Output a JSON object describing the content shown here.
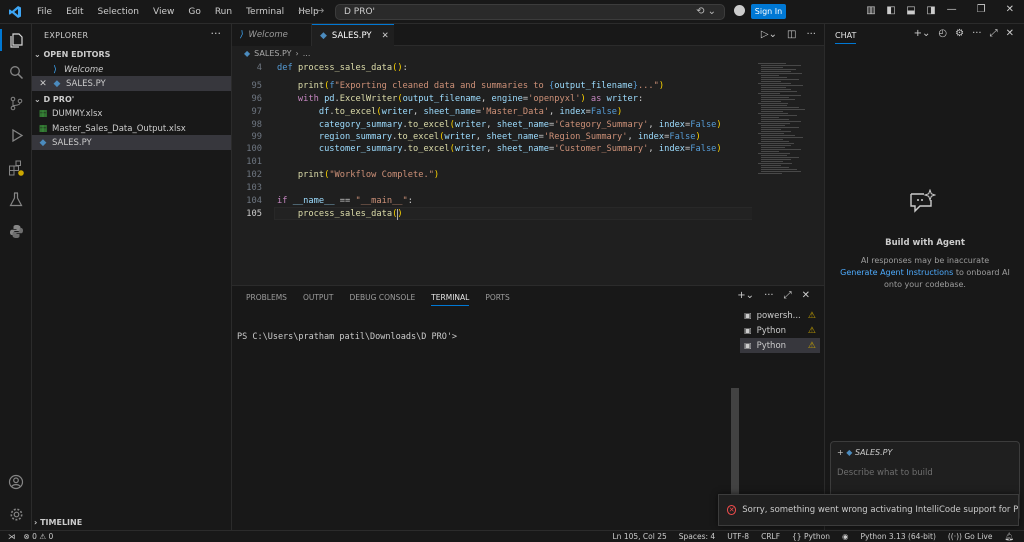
{
  "titlebar": {
    "menu": [
      "File",
      "Edit",
      "Selection",
      "View",
      "Go",
      "Run",
      "Terminal",
      "Help"
    ],
    "search_text": "D PRO'",
    "sign_in": "Sign In"
  },
  "sidebar": {
    "title": "EXPLORER",
    "open_editors_label": "OPEN EDITORS",
    "open_editors": [
      "Welcome",
      "SALES.PY"
    ],
    "folder_label": "D PRO'",
    "files": [
      "DUMMY.xlsx",
      "Master_Sales_Data_Output.xlsx",
      "SALES.PY"
    ],
    "timeline_label": "TIMELINE"
  },
  "editor": {
    "tabs": [
      "Welcome",
      "SALES.PY"
    ],
    "breadcrumb": "SALES.PY",
    "lines": [
      {
        "n": "4",
        "text": "def process_sales_data():"
      },
      {
        "n": "95",
        "text": "    print(f\"Exporting cleaned data and summaries to {output_filename}...\")"
      },
      {
        "n": "96",
        "text": "    with pd.ExcelWriter(output_filename, engine='openpyxl') as writer:"
      },
      {
        "n": "97",
        "text": "        df.to_excel(writer, sheet_name='Master_Data', index=False)"
      },
      {
        "n": "98",
        "text": "        category_summary.to_excel(writer, sheet_name='Category_Summary', index=False)"
      },
      {
        "n": "99",
        "text": "        region_summary.to_excel(writer, sheet_name='Region_Summary', index=False)"
      },
      {
        "n": "100",
        "text": "        customer_summary.to_excel(writer, sheet_name='Customer_Summary', index=False)"
      },
      {
        "n": "101",
        "text": ""
      },
      {
        "n": "102",
        "text": "    print(\"Workflow Complete.\")"
      },
      {
        "n": "103",
        "text": ""
      },
      {
        "n": "104",
        "text": "if __name__ == \"__main__\":"
      },
      {
        "n": "105",
        "text": "    process_sales_data()"
      }
    ]
  },
  "panel": {
    "tabs": [
      "PROBLEMS",
      "OUTPUT",
      "DEBUG CONSOLE",
      "TERMINAL",
      "PORTS"
    ],
    "active_tab": "TERMINAL",
    "prompt": "PS C:\\Users\\pratham patil\\Downloads\\D PRO'>",
    "terminals": [
      "powersh...",
      "Python",
      "Python"
    ]
  },
  "chat": {
    "title": "CHAT",
    "heading": "Build with Agent",
    "desc1": "AI responses may be inaccurate",
    "link": "Generate Agent Instructions",
    "desc2": "to onboard AI onto your codebase.",
    "file_chip": "SALES.PY",
    "placeholder": "Describe what to build"
  },
  "toast": {
    "message": "Sorry, something went wrong activating IntelliCode support for Pytho..."
  },
  "statusbar": {
    "errors": "0",
    "warnings": "0",
    "position": "Ln 105, Col 25",
    "spaces": "Spaces: 4",
    "encoding": "UTF-8",
    "eol": "CRLF",
    "language": "Python",
    "interpreter": "Python 3.13 (64-bit)",
    "golive": "Go Live"
  },
  "colors": {
    "accent": "#0078d4",
    "background": "#1f1f1f",
    "sidebar": "#181818",
    "error": "#f14c4c",
    "warning": "#cca700"
  }
}
